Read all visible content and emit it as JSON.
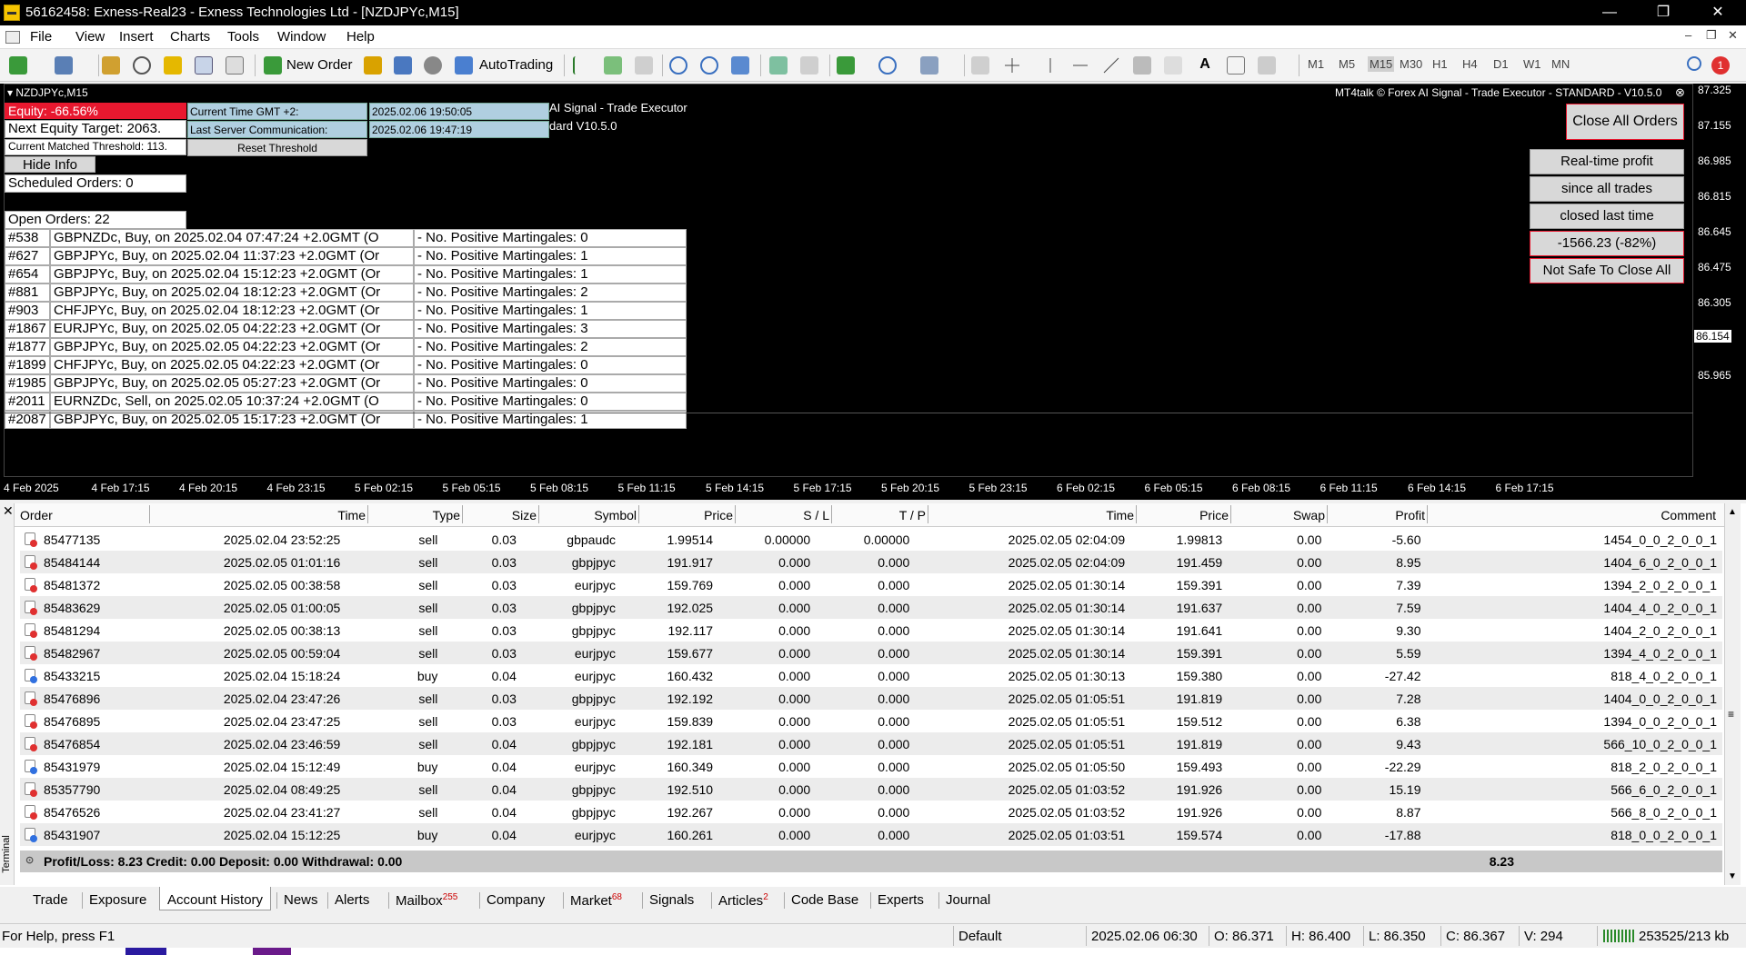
{
  "window": {
    "title": "56162458: Exness-Real23 - Exness Technologies Ltd - [NZDJPYc,M15]",
    "minimize": "—",
    "restore": "❐",
    "close": "✕"
  },
  "menu": {
    "items": [
      "File",
      "View",
      "Insert",
      "Charts",
      "Tools",
      "Window",
      "Help"
    ],
    "mdi": [
      "–",
      "❐",
      "✕"
    ]
  },
  "toolbar": {
    "new_order": "New Order",
    "autotrading": "AutoTrading",
    "timeframes": [
      "M1",
      "M5",
      "M15",
      "M30",
      "H1",
      "H4",
      "D1",
      "W1",
      "MN"
    ],
    "active_timeframe": "M15",
    "notification_count": "1"
  },
  "chart": {
    "symbol_header": "NZDJPYc,M15",
    "ea_title": "MT4talk © Forex AI Signal - Trade Executor - STANDARD - V10.5.0",
    "ea_partial_1": "AI Signal - Trade Executor",
    "ea_partial_2": "dard V10.5.0",
    "equity": "Equity: -66.56%",
    "next_equity_target": "Next Equity Target: 2063.",
    "threshold": "Current Matched Threshold: 113.",
    "current_time_label": "Current Time GMT +2:",
    "current_time_value": "2025.02.06 19:50:05",
    "last_server_label": "Last Server Communication:",
    "last_server_value": "2025.02.06 19:47:19",
    "reset_threshold": "Reset Threshold",
    "hide_info": "Hide Info",
    "scheduled_orders": "Scheduled Orders: 0",
    "open_orders": "Open Orders: 22",
    "order_lines": [
      {
        "id": "#538",
        "text": "GBPNZDc, Buy, on 2025.02.04 07:47:24 +2.0GMT  (O",
        "mart": "- No. Positive Martingales: 0"
      },
      {
        "id": "#627",
        "text": "GBPJPYc, Buy, on 2025.02.04 11:37:23 +2.0GMT  (Or",
        "mart": "- No. Positive Martingales: 1"
      },
      {
        "id": "#654",
        "text": "GBPJPYc, Buy, on 2025.02.04 15:12:23 +2.0GMT  (Or",
        "mart": "- No. Positive Martingales: 1"
      },
      {
        "id": "#881",
        "text": "GBPJPYc, Buy, on 2025.02.04 18:12:23 +2.0GMT  (Or",
        "mart": "- No. Positive Martingales: 2"
      },
      {
        "id": "#903",
        "text": "CHFJPYc, Buy, on 2025.02.04 18:12:23 +2.0GMT  (Or",
        "mart": "- No. Positive Martingales: 1"
      },
      {
        "id": "#1867",
        "text": "EURJPYc, Buy, on 2025.02.05 04:22:23 +2.0GMT  (Or",
        "mart": "- No. Positive Martingales: 3"
      },
      {
        "id": "#1877",
        "text": "GBPJPYc, Buy, on 2025.02.05 04:22:23 +2.0GMT  (Or",
        "mart": "- No. Positive Martingales: 2"
      },
      {
        "id": "#1899",
        "text": "CHFJPYc, Buy, on 2025.02.05 04:22:23 +2.0GMT  (Or",
        "mart": "- No. Positive Martingales: 0"
      },
      {
        "id": "#1985",
        "text": "GBPJPYc, Buy, on 2025.02.05 05:27:23 +2.0GMT  (Or",
        "mart": "- No. Positive Martingales: 0"
      },
      {
        "id": "#2011",
        "text": "EURNZDc, Sell, on 2025.02.05 10:37:24 +2.0GMT  (O",
        "mart": "- No. Positive Martingales: 0"
      },
      {
        "id": "#2087",
        "text": "GBPJPYc, Buy, on 2025.02.05 15:17:23 +2.0GMT  (Or",
        "mart": "- No. Positive Martingales: 1"
      }
    ],
    "close_all": "Close All Orders",
    "realtime_1": "Real-time profit",
    "realtime_2": "since all trades",
    "realtime_3": "closed last time",
    "realtime_value": "-1566.23 (-82%)",
    "not_safe": "Not Safe To Close All",
    "price_labels": [
      "87.325",
      "87.155",
      "86.985",
      "86.815",
      "86.645",
      "86.475",
      "86.305",
      "86.154",
      "85.965"
    ],
    "current_price": "86.154",
    "time_labels": [
      "4 Feb 2025",
      "4 Feb 17:15",
      "4 Feb 20:15",
      "4 Feb 23:15",
      "5 Feb 02:15",
      "5 Feb 05:15",
      "5 Feb 08:15",
      "5 Feb 11:15",
      "5 Feb 14:15",
      "5 Feb 17:15",
      "5 Feb 20:15",
      "5 Feb 23:15",
      "6 Feb 02:15",
      "6 Feb 05:15",
      "6 Feb 08:15",
      "6 Feb 11:15",
      "6 Feb 14:15",
      "6 Feb 17:15"
    ]
  },
  "terminal": {
    "side_label": "Terminal",
    "columns": [
      "Order",
      "Time",
      "Type",
      "Size",
      "Symbol",
      "Price",
      "S / L",
      "T / P",
      "Time",
      "Price",
      "Swap",
      "Profit",
      "Comment"
    ],
    "rows": [
      {
        "order": "85477135",
        "time": "2025.02.04 23:52:25",
        "type": "sell",
        "size": "0.03",
        "symbol": "gbpaudc",
        "price": "1.99514",
        "sl": "0.00000",
        "tp": "0.00000",
        "ctime": "2025.02.05 02:04:09",
        "cprice": "1.99813",
        "swap": "0.00",
        "profit": "-5.60",
        "comment": "1454_0_0_2_0_0_1"
      },
      {
        "order": "85484144",
        "time": "2025.02.05 01:01:16",
        "type": "sell",
        "size": "0.03",
        "symbol": "gbpjpyc",
        "price": "191.917",
        "sl": "0.000",
        "tp": "0.000",
        "ctime": "2025.02.05 02:04:09",
        "cprice": "191.459",
        "swap": "0.00",
        "profit": "8.95",
        "comment": "1404_6_0_2_0_0_1"
      },
      {
        "order": "85481372",
        "time": "2025.02.05 00:38:58",
        "type": "sell",
        "size": "0.03",
        "symbol": "eurjpyc",
        "price": "159.769",
        "sl": "0.000",
        "tp": "0.000",
        "ctime": "2025.02.05 01:30:14",
        "cprice": "159.391",
        "swap": "0.00",
        "profit": "7.39",
        "comment": "1394_2_0_2_0_0_1"
      },
      {
        "order": "85483629",
        "time": "2025.02.05 01:00:05",
        "type": "sell",
        "size": "0.03",
        "symbol": "gbpjpyc",
        "price": "192.025",
        "sl": "0.000",
        "tp": "0.000",
        "ctime": "2025.02.05 01:30:14",
        "cprice": "191.637",
        "swap": "0.00",
        "profit": "7.59",
        "comment": "1404_4_0_2_0_0_1"
      },
      {
        "order": "85481294",
        "time": "2025.02.05 00:38:13",
        "type": "sell",
        "size": "0.03",
        "symbol": "gbpjpyc",
        "price": "192.117",
        "sl": "0.000",
        "tp": "0.000",
        "ctime": "2025.02.05 01:30:14",
        "cprice": "191.641",
        "swap": "0.00",
        "profit": "9.30",
        "comment": "1404_2_0_2_0_0_1"
      },
      {
        "order": "85482967",
        "time": "2025.02.05 00:59:04",
        "type": "sell",
        "size": "0.03",
        "symbol": "eurjpyc",
        "price": "159.677",
        "sl": "0.000",
        "tp": "0.000",
        "ctime": "2025.02.05 01:30:14",
        "cprice": "159.391",
        "swap": "0.00",
        "profit": "5.59",
        "comment": "1394_4_0_2_0_0_1"
      },
      {
        "order": "85433215",
        "time": "2025.02.04 15:18:24",
        "type": "buy",
        "size": "0.04",
        "symbol": "eurjpyc",
        "price": "160.432",
        "sl": "0.000",
        "tp": "0.000",
        "ctime": "2025.02.05 01:30:13",
        "cprice": "159.380",
        "swap": "0.00",
        "profit": "-27.42",
        "comment": "818_4_0_2_0_0_1"
      },
      {
        "order": "85476896",
        "time": "2025.02.04 23:47:26",
        "type": "sell",
        "size": "0.03",
        "symbol": "gbpjpyc",
        "price": "192.192",
        "sl": "0.000",
        "tp": "0.000",
        "ctime": "2025.02.05 01:05:51",
        "cprice": "191.819",
        "swap": "0.00",
        "profit": "7.28",
        "comment": "1404_0_0_2_0_0_1"
      },
      {
        "order": "85476895",
        "time": "2025.02.04 23:47:25",
        "type": "sell",
        "size": "0.03",
        "symbol": "eurjpyc",
        "price": "159.839",
        "sl": "0.000",
        "tp": "0.000",
        "ctime": "2025.02.05 01:05:51",
        "cprice": "159.512",
        "swap": "0.00",
        "profit": "6.38",
        "comment": "1394_0_0_2_0_0_1"
      },
      {
        "order": "85476854",
        "time": "2025.02.04 23:46:59",
        "type": "sell",
        "size": "0.04",
        "symbol": "gbpjpyc",
        "price": "192.181",
        "sl": "0.000",
        "tp": "0.000",
        "ctime": "2025.02.05 01:05:51",
        "cprice": "191.819",
        "swap": "0.00",
        "profit": "9.43",
        "comment": "566_10_0_2_0_0_1"
      },
      {
        "order": "85431979",
        "time": "2025.02.04 15:12:49",
        "type": "buy",
        "size": "0.04",
        "symbol": "eurjpyc",
        "price": "160.349",
        "sl": "0.000",
        "tp": "0.000",
        "ctime": "2025.02.05 01:05:50",
        "cprice": "159.493",
        "swap": "0.00",
        "profit": "-22.29",
        "comment": "818_2_0_2_0_0_1"
      },
      {
        "order": "85357790",
        "time": "2025.02.04 08:49:25",
        "type": "sell",
        "size": "0.04",
        "symbol": "gbpjpyc",
        "price": "192.510",
        "sl": "0.000",
        "tp": "0.000",
        "ctime": "2025.02.05 01:03:52",
        "cprice": "191.926",
        "swap": "0.00",
        "profit": "15.19",
        "comment": "566_6_0_2_0_0_1"
      },
      {
        "order": "85476526",
        "time": "2025.02.04 23:41:27",
        "type": "sell",
        "size": "0.04",
        "symbol": "gbpjpyc",
        "price": "192.267",
        "sl": "0.000",
        "tp": "0.000",
        "ctime": "2025.02.05 01:03:52",
        "cprice": "191.926",
        "swap": "0.00",
        "profit": "8.87",
        "comment": "566_8_0_2_0_0_1"
      },
      {
        "order": "85431907",
        "time": "2025.02.04 15:12:25",
        "type": "buy",
        "size": "0.04",
        "symbol": "eurjpyc",
        "price": "160.261",
        "sl": "0.000",
        "tp": "0.000",
        "ctime": "2025.02.05 01:03:51",
        "cprice": "159.574",
        "swap": "0.00",
        "profit": "-17.88",
        "comment": "818_0_0_2_0_0_1"
      }
    ],
    "summary": "Profit/Loss: 8.23  Credit: 0.00  Deposit: 0.00  Withdrawal: 0.00",
    "summary_total": "8.23"
  },
  "tabs": [
    {
      "label": "Trade",
      "badge": ""
    },
    {
      "label": "Exposure",
      "badge": ""
    },
    {
      "label": "Account History",
      "badge": ""
    },
    {
      "label": "News",
      "badge": ""
    },
    {
      "label": "Alerts",
      "badge": ""
    },
    {
      "label": "Mailbox",
      "badge": "255"
    },
    {
      "label": "Company",
      "badge": ""
    },
    {
      "label": "Market",
      "badge": "68"
    },
    {
      "label": "Signals",
      "badge": ""
    },
    {
      "label": "Articles",
      "badge": "2"
    },
    {
      "label": "Code Base",
      "badge": ""
    },
    {
      "label": "Experts",
      "badge": ""
    },
    {
      "label": "Journal",
      "badge": ""
    }
  ],
  "active_tab": "Account History",
  "status": {
    "help": "For Help, press F1",
    "profile": "Default",
    "datetime": "2025.02.06 06:30",
    "open": "O: 86.371",
    "high": "H: 86.400",
    "low": "L: 86.350",
    "close": "C: 86.367",
    "volume": "V: 294",
    "traffic": "253525/213 kb"
  },
  "colors": {
    "red_box": "#e8182f",
    "blue_box": "#b0cfe0",
    "chart_bg": "#000000"
  }
}
